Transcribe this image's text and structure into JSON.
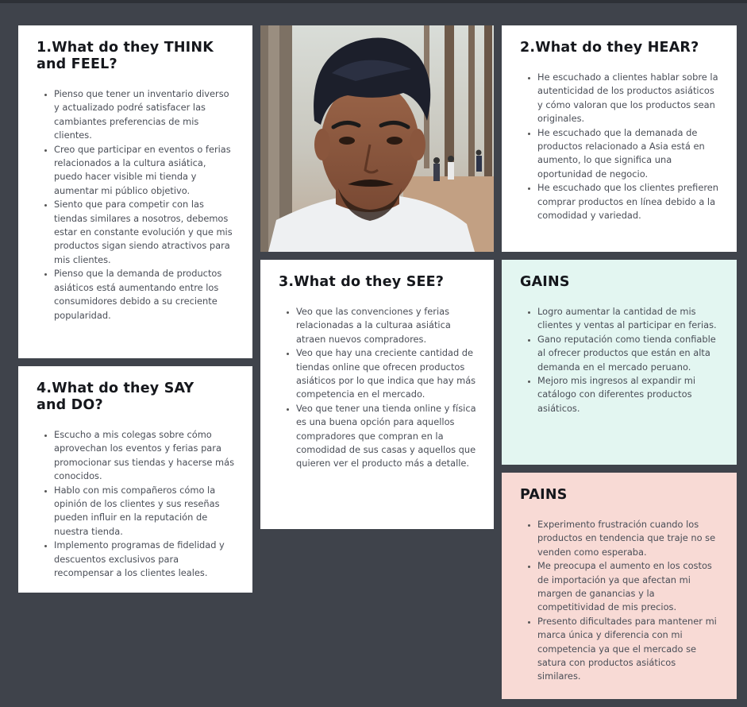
{
  "think": {
    "title_line1": "1.What do they THINK",
    "title_line2": "and FEEL?",
    "items": [
      "Pienso que tener un inventario diverso y actualizado podré satisfacer las cambiantes preferencias de mis clientes.",
      "Creo que participar en eventos o ferias relacionados a la cultura asiática, puedo hacer visible mi tienda y aumentar mi público objetivo.",
      "Siento que para competir con las tiendas similares a nosotros, debemos estar en constante evolución y que mis productos sigan siendo atractivos para mis clientes.",
      "Pienso que la demanda de productos asiáticos está aumentando entre los consumidores debido a su creciente popularidad."
    ]
  },
  "say": {
    "title_line1": "4.What do they SAY",
    "title_line2": "and DO?",
    "items": [
      "Escucho a mis colegas sobre cómo aprovechan los eventos y ferias para promocionar sus tiendas y hacerse más conocidos.",
      "Hablo con mis compañeros cómo la opinión de los clientes y sus reseñas pueden influir en la reputación de nuestra tienda.",
      "Implemento programas de fidelidad y descuentos exclusivos para recompensar a los clientes leales."
    ]
  },
  "see": {
    "title": "3.What do they SEE?",
    "items": [
      "Veo que las convenciones y ferias relacionadas a la culturaa asiática atraen nuevos compradores.",
      "Veo que hay una creciente cantidad de tiendas online que ofrecen productos asiáticos por lo que indica que hay más competencia en el mercado.",
      "Veo que tener una tienda online y física es una buena opción para aquellos compradores que compran en la comodidad de sus casas y aquellos que quieren ver el producto más a detalle."
    ]
  },
  "hear": {
    "title": "2.What do they HEAR?",
    "items": [
      "He escuchado a clientes hablar sobre la autenticidad de los productos asiáticos y cómo valoran que los productos sean originales.",
      "He escuchado que la demanada de productos relacionado a Asia está en aumento, lo que significa una oportunidad de negocio.",
      "He escuchado que los clientes prefieren comprar productos en línea debido a la comodidad y variedad."
    ]
  },
  "gains": {
    "title": "GAINS",
    "items": [
      "Logro aumentar la cantidad de mis clientes y ventas al participar en ferias.",
      "Gano reputación como tienda confiable al ofrecer productos que están en alta demanda en el mercado peruano.",
      "Mejoro mis ingresos al expandir mi catálogo con diferentes productos asiáticos."
    ]
  },
  "pains": {
    "title": "PAINS",
    "items": [
      "Experimento frustración cuando los productos en tendencia que traje no se venden como esperaba.",
      "Me preocupa el aumento en los costos de importación ya que afectan mi margen de ganancias y la competitividad de mis precios.",
      "Presento dificultades para mantener mi marca única y diferencia con mi competencia ya que el mercado se satura con productos asiáticos similares."
    ]
  },
  "colors": {
    "background": "#3f434b",
    "card": "#ffffff",
    "gains_bg": "#e3f6f1",
    "pains_bg": "#f8dad5"
  }
}
